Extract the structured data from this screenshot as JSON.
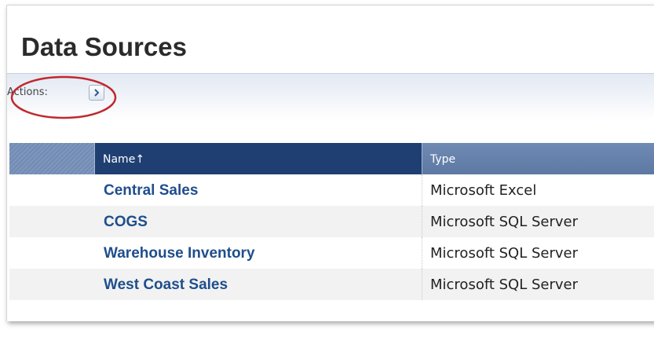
{
  "page": {
    "title": "Data Sources"
  },
  "actions": {
    "label": "Actions:",
    "button_glyph": ">"
  },
  "table": {
    "columns": {
      "name": "Name",
      "name_sort_indicator": "↑",
      "type": "Type"
    },
    "rows": [
      {
        "name": "Central Sales",
        "type": "Microsoft Excel"
      },
      {
        "name": "COGS",
        "type": "Microsoft SQL Server"
      },
      {
        "name": "Warehouse Inventory",
        "type": "Microsoft SQL Server"
      },
      {
        "name": "West Coast Sales",
        "type": "Microsoft SQL Server"
      }
    ]
  },
  "colors": {
    "header_selected": "#1f3f72",
    "header": "#5d79a3",
    "link": "#1f4e8c",
    "highlight_ellipse": "#c0282d"
  },
  "icons": {
    "actions_button": "chevron-right-icon",
    "sort": "sort-ascending-icon"
  }
}
